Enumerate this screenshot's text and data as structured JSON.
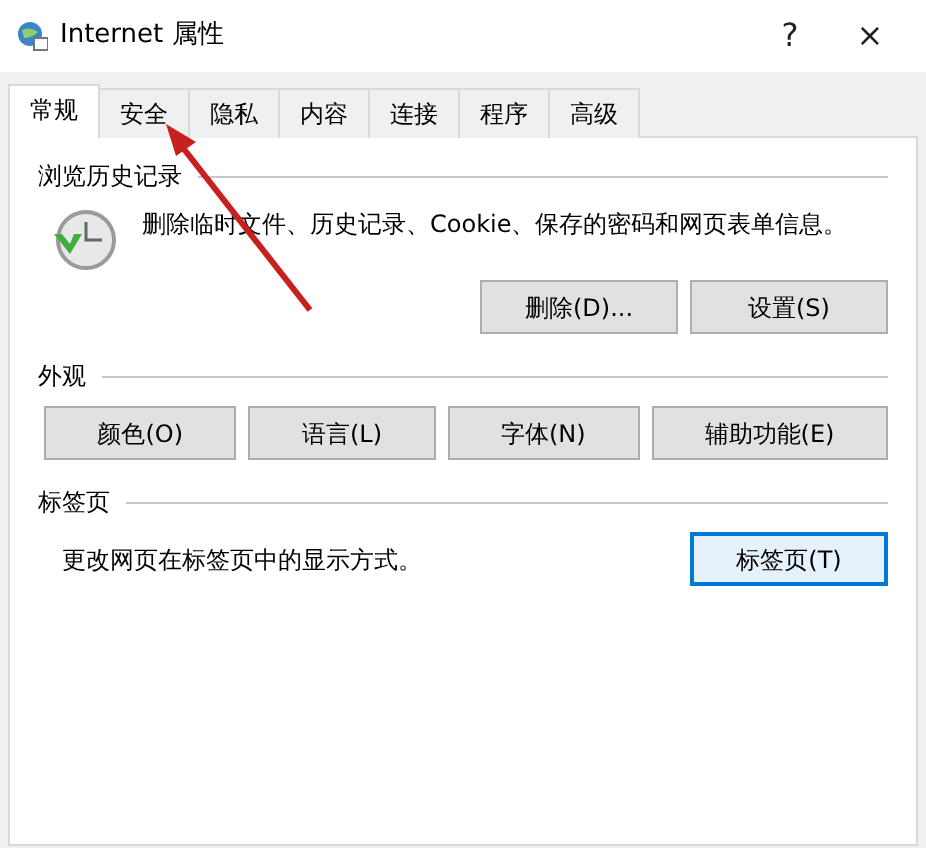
{
  "window": {
    "title": "Internet 属性",
    "help": "?",
    "close": "×"
  },
  "tabs": [
    {
      "label": "常规",
      "selected": true
    },
    {
      "label": "安全",
      "selected": false
    },
    {
      "label": "隐私",
      "selected": false
    },
    {
      "label": "内容",
      "selected": false
    },
    {
      "label": "连接",
      "selected": false
    },
    {
      "label": "程序",
      "selected": false
    },
    {
      "label": "高级",
      "selected": false
    }
  ],
  "sections": [
    {
      "kind": "history",
      "heading": "浏览历史记录",
      "description": "删除临时文件、历史记录、Cookie、保存的密码和网页表单信息。",
      "buttons": [
        {
          "label": "删除(D)...",
          "focused": false
        },
        {
          "label": "设置(S)",
          "focused": false
        }
      ]
    },
    {
      "kind": "grid",
      "heading": "外观",
      "buttons": [
        {
          "label": "颜色(O)",
          "focused": false
        },
        {
          "label": "语言(L)",
          "focused": false
        },
        {
          "label": "字体(N)",
          "focused": false
        },
        {
          "label": "辅助功能(E)",
          "focused": false
        }
      ]
    },
    {
      "kind": "inline",
      "heading": "标签页",
      "description": "更改网页在标签页中的显示方式。",
      "buttons": [
        {
          "label": "标签页(T)",
          "focused": true
        }
      ]
    }
  ]
}
